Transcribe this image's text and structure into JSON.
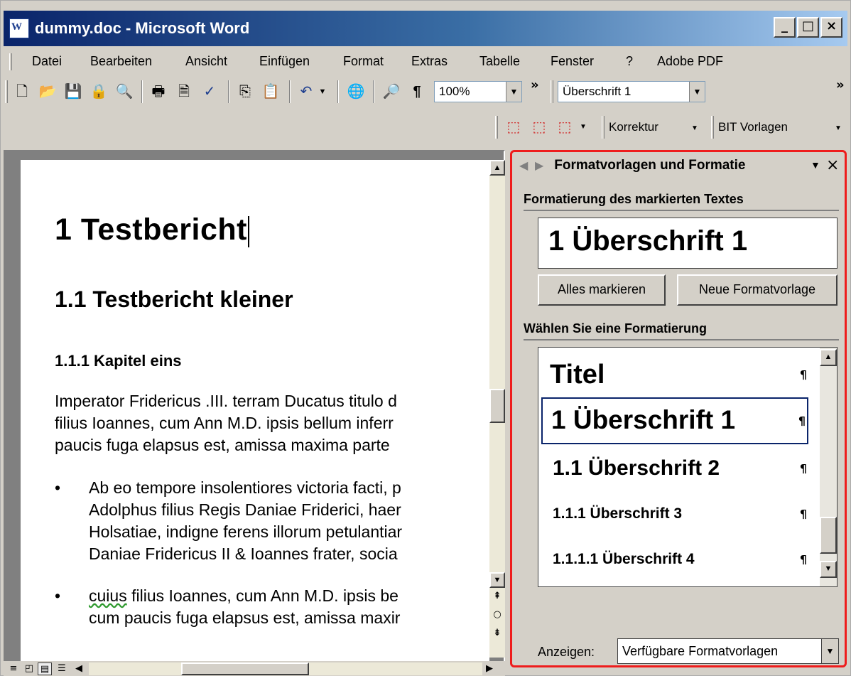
{
  "window": {
    "title": "dummy.doc - Microsoft Word",
    "icon_glyph": "W",
    "buttons": {
      "minimize": "_",
      "maximize": "□",
      "close": "×"
    }
  },
  "menu": [
    "Datei",
    "Bearbeiten",
    "Ansicht",
    "Einfügen",
    "Format",
    "Extras",
    "Tabelle",
    "Fenster",
    "?",
    "Adobe PDF"
  ],
  "toolbar": {
    "zoom": "100%",
    "style": "Überschrift 1",
    "korrektur": "Korrektur",
    "bit_vorlagen": "BIT Vorlagen",
    "chevron": "»"
  },
  "document": {
    "heading1": "1  Testbericht",
    "heading2": "1.1    Testbericht kleiner",
    "heading3": "1.1.1    Kapitel eins",
    "paragraph": [
      "Imperator Fridericus .III. terram Ducatus titulo d",
      "filius Ioannes, cum Ann M.D. ipsis bellum inferr",
      "paucis fuga elapsus est, amissa maxima parte"
    ],
    "bullets": [
      {
        "marker": "•",
        "lines": [
          "Ab eo tempore insolentiores victoria facti, p",
          "Adolphus filius Regis Daniae Friderici, haer",
          "Holsatiae, indigne ferens illorum petulantiar",
          "Daniae Fridericus II & Ioannes frater, socia"
        ]
      },
      {
        "marker": "•",
        "squiggle_word": "cuius",
        "lines": [
          " filius Ioannes, cum Ann M.D. ipsis be",
          "cum paucis fuga elapsus est, amissa maxir"
        ]
      }
    ]
  },
  "taskpane": {
    "title": "Formatvorlagen und Formatie",
    "dropdown_glyph": "▼",
    "close_glyph": "×",
    "section_current": "Formatierung des markierten Textes",
    "current_format": "1  Überschrift 1",
    "select_all_button": "Alles markieren",
    "new_style_button": "Neue Formatvorlage",
    "section_choose": "Wählen Sie eine Formatierung",
    "pilcrow": "¶",
    "styles": [
      "Titel",
      "1  Überschrift 1",
      "1.1  Überschrift 2",
      "1.1.1  Überschrift 3",
      "1.1.1.1  Überschrift 4"
    ],
    "selected_style_index": 1,
    "show_label": "Anzeigen:",
    "show_value": "Verfügbare Formatvorlagen"
  },
  "colors": {
    "selection_border": "#0a246a",
    "highlight_frame": "#ee1c1c",
    "title_start": "#0a246a",
    "title_end": "#a6caf0"
  }
}
